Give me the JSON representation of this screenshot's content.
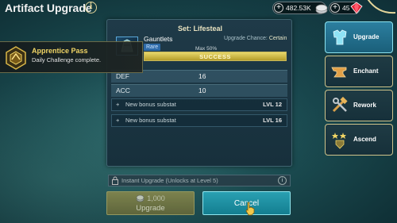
{
  "topbar": {
    "title": "Artifact Upgrade",
    "info_icon": "i",
    "silver": "482.53K",
    "gems": "45",
    "plus": "+"
  },
  "toast": {
    "title": "Apprentice Pass",
    "subtitle": "Daily Challenge complete.",
    "icon": "apprentice-emblem-icon"
  },
  "panel": {
    "set_title": "Set: Lifesteal",
    "item_name": "Gauntlets",
    "rarity": "Rare",
    "chance_label": "Upgrade Chance:",
    "chance_value": "Certain",
    "max_label": "Max 50%",
    "success_text": "SUCCESS",
    "success_fill": 1.0,
    "stats": [
      {
        "name": "DEF",
        "value": "16"
      },
      {
        "name": "ACC",
        "value": "10"
      }
    ],
    "substats": [
      {
        "plus": "+",
        "label": "New bonus substat",
        "level": "LVL 12"
      },
      {
        "plus": "+",
        "label": "New bonus substat",
        "level": "LVL 16"
      }
    ]
  },
  "instant": {
    "text": "Instant Upgrade (Unlocks at Level 5)",
    "info": "i"
  },
  "buttons": {
    "upgrade_cost": "1,000",
    "upgrade_label": "Upgrade",
    "cancel_label": "Cancel"
  },
  "tabs": [
    {
      "label": "Upgrade",
      "icon": "armor-icon",
      "active": true
    },
    {
      "label": "Enchant",
      "icon": "anvil-icon",
      "active": false
    },
    {
      "label": "Rework",
      "icon": "hammer-wrench-icon",
      "active": false
    },
    {
      "label": "Ascend",
      "icon": "ascend-stars-icon",
      "active": false
    }
  ],
  "colors": {
    "accent_gold": "#e3d59a",
    "active_tab": "#2c7fa0",
    "cancel_button": "#2aa0b2",
    "rarity_blue": "#2d6aa8"
  }
}
